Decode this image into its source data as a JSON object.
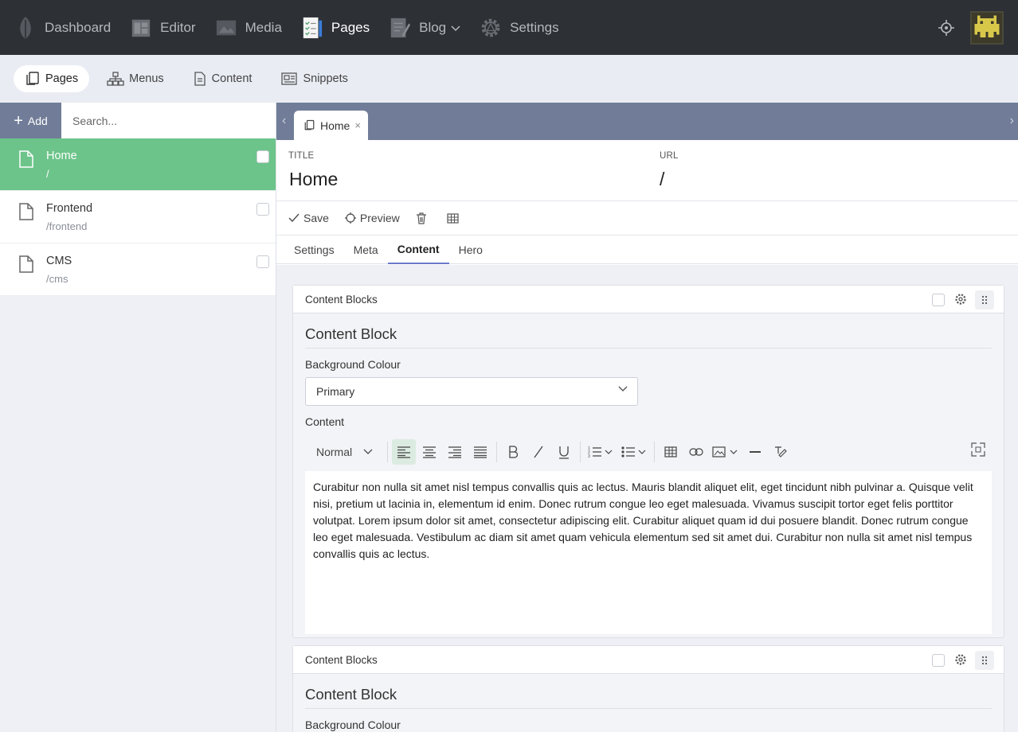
{
  "topnav": {
    "items": [
      {
        "label": "Dashboard",
        "icon": "leaf-icon"
      },
      {
        "label": "Editor",
        "icon": "editor-icon"
      },
      {
        "label": "Media",
        "icon": "media-icon"
      },
      {
        "label": "Pages",
        "icon": "pages-icon"
      },
      {
        "label": "Blog",
        "icon": "blog-icon"
      },
      {
        "label": "Settings",
        "icon": "settings-icon"
      }
    ],
    "active": "Pages"
  },
  "subnav": {
    "items": [
      {
        "label": "Pages",
        "icon": "pages-icon"
      },
      {
        "label": "Menus",
        "icon": "sitemap-icon"
      },
      {
        "label": "Content",
        "icon": "document-icon"
      },
      {
        "label": "Snippets",
        "icon": "snippets-icon"
      }
    ],
    "active": "Pages"
  },
  "sidebar": {
    "add_label": "Add",
    "search_placeholder": "Search...",
    "pages": [
      {
        "name": "Home",
        "slug": "/"
      },
      {
        "name": "Frontend",
        "slug": "/frontend"
      },
      {
        "name": "CMS",
        "slug": "/cms"
      }
    ]
  },
  "editor_tab": {
    "label": "Home",
    "close": "×"
  },
  "page_meta": {
    "title_label": "TITLE",
    "title_value": "Home",
    "url_label": "URL",
    "url_value": "/"
  },
  "actions": {
    "save": "Save",
    "preview": "Preview"
  },
  "section_tabs": [
    "Settings",
    "Meta",
    "Content",
    "Hero"
  ],
  "active_section_tab": "Content",
  "blocks": [
    {
      "header": "Content Blocks",
      "title": "Content Block",
      "bg_label": "Background Colour",
      "bg_value": "Primary",
      "content_label": "Content",
      "format": "Normal",
      "text": "Curabitur non nulla sit amet nisl tempus convallis quis ac lectus. Mauris blandit aliquet elit, eget tincidunt nibh pulvinar a. Quisque velit nisi, pretium ut lacinia in, elementum id enim. Donec rutrum congue leo eget malesuada. Vivamus suscipit tortor eget felis porttitor volutpat. Lorem ipsum dolor sit amet, consectetur adipiscing elit. Curabitur aliquet quam id dui posuere blandit. Donec rutrum congue leo eget malesuada. Vestibulum ac diam sit amet quam vehicula elementum sed sit amet dui. Curabitur non nulla sit amet nisl tempus convallis quis ac lectus."
    },
    {
      "header": "Content Blocks",
      "title": "Content Block",
      "bg_label": "Background Colour"
    }
  ],
  "colors": {
    "accent_green": "#6cc48a",
    "slate": "#717d98",
    "topbar": "#2d3035",
    "tab_underline": "#6b79c9"
  }
}
